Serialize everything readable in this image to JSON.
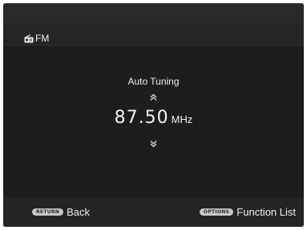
{
  "header": {
    "icon": "radio-icon",
    "title": "FM"
  },
  "tuner": {
    "mode": "Auto Tuning",
    "up_icon": "chevron-double-up-icon",
    "down_icon": "chevron-double-down-icon",
    "frequency": "87.50",
    "unit": "MHz"
  },
  "footer": {
    "back": {
      "key": "RETURN",
      "label": "Back"
    },
    "function_list": {
      "key": "OPTIONS",
      "label": "Function List"
    }
  },
  "colors": {
    "background": "#222222",
    "text": "#f0f0f0",
    "key_badge": "#c8c8c8"
  }
}
